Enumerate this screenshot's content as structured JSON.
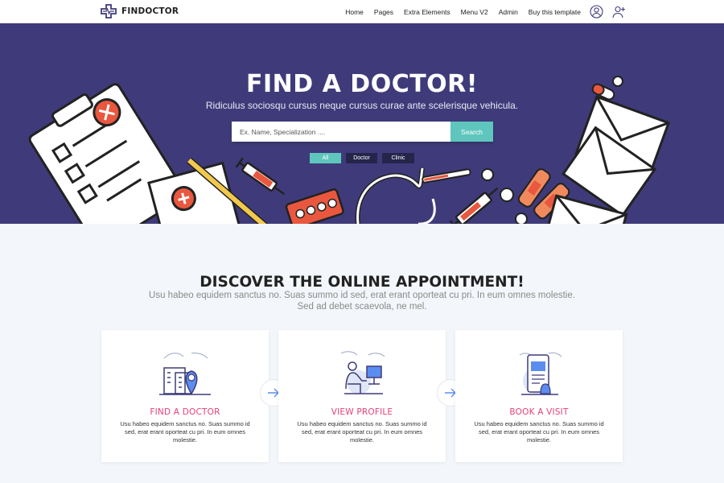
{
  "brand": {
    "name": "FINDOCTOR"
  },
  "nav": {
    "items": [
      "Home",
      "Pages",
      "Extra Elements",
      "Menu V2",
      "Admin",
      "Buy this template"
    ],
    "icons": [
      "user-circle-icon",
      "add-user-icon"
    ]
  },
  "hero": {
    "title": "FIND A DOCTOR!",
    "subtitle": "Ridiculus sociosqu cursus neque cursus curae ante scelerisque vehicula.",
    "search_placeholder": "Ex. Name, Specialization ....",
    "search_button": "Search",
    "filters": [
      "All",
      "Doctor",
      "Clinic"
    ],
    "active_filter": "All"
  },
  "section": {
    "title_pre": "DISCOVER THE ",
    "title_bold": "ONLINE",
    "title_post": " APPOINTMENT!",
    "subtitle_line1": "Usu habeo equidem sanctus no. Suas summo id sed, erat erant oporteat cu pri. In eum omnes molestie.",
    "subtitle_line2": "Sed ad debet scaevola, ne mel."
  },
  "cards": [
    {
      "title": "FIND A DOCTOR",
      "icon": "hospital-location-icon",
      "text": "Usu habeo equidem sanctus no. Suas summo id sed, erat erant oporteat cu pri. In eum omnes molestie."
    },
    {
      "title": "VIEW PROFILE",
      "icon": "doctor-computer-icon",
      "text": "Usu habeo equidem sanctus no. Suas summo id sed, erat erant oporteat cu pri. In eum omnes molestie."
    },
    {
      "title": "BOOK A VISIT",
      "icon": "mobile-booking-icon",
      "text": "Usu habeo equidem sanctus no. Suas summo id sed, erat erant oporteat cu pri. In eum omnes molestie."
    }
  ],
  "colors": {
    "hero_bg": "#3f3b7a",
    "accent_teal": "#5fc6bd",
    "accent_pink": "#e83e7a",
    "page_bg": "#f3f6fa"
  }
}
